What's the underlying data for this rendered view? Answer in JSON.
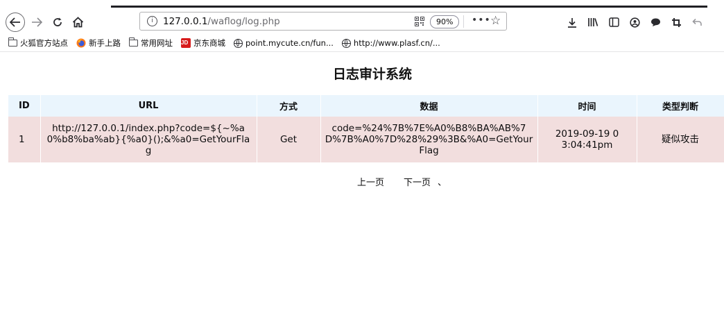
{
  "browser": {
    "url_host": "127.0.0.1",
    "url_path": "/waflog/log.php",
    "zoom": "90%",
    "bookmarks": [
      {
        "label": "火狐官方站点",
        "icon": "folder-icon"
      },
      {
        "label": "新手上路",
        "icon": "firefox-icon"
      },
      {
        "label": "常用网址",
        "icon": "folder-icon"
      },
      {
        "label": "京东商城",
        "icon": "jd-icon",
        "icon_text": "JD"
      },
      {
        "label": "point.mycute.cn/fun...",
        "icon": "globe-icon"
      },
      {
        "label": "http://www.plasf.cn/...",
        "icon": "globe-icon"
      }
    ]
  },
  "page": {
    "title": "日志审计系统",
    "table": {
      "headers": [
        "ID",
        "URL",
        "方式",
        "数据",
        "时间",
        "类型判断"
      ],
      "rows": [
        {
          "id": "1",
          "url": "http://127.0.0.1/index.php?code=${~%a0%b8%ba%ab}{%a0}();&%a0=GetYourFlag",
          "method": "Get",
          "data": "code=%24%7B%7E%A0%B8%BA%AB%7D%7B%A0%7D%28%29%3B&%A0=GetYourFlag",
          "time": "2019-09-19 03:04:41pm",
          "type": "疑似攻击"
        }
      ]
    },
    "pager": {
      "prev": "上一页",
      "next": "下一页",
      "mark": "、"
    }
  },
  "colors": {
    "header_bg": "#eaf5fd",
    "row_bg": "#f2dede"
  }
}
